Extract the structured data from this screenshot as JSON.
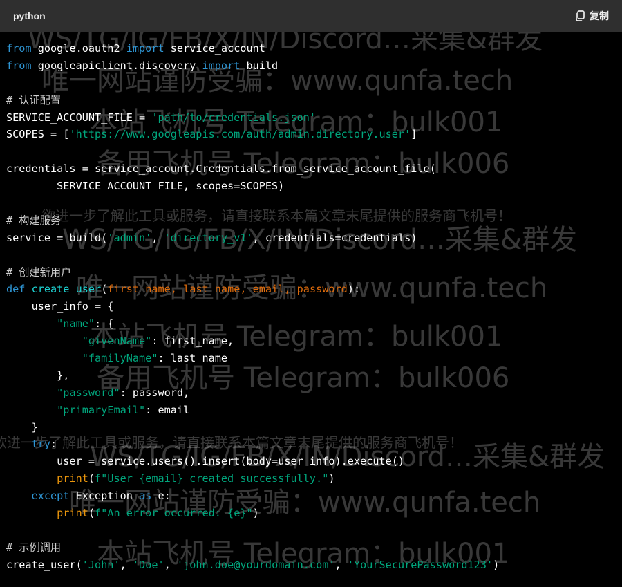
{
  "header": {
    "language": "python",
    "copy_label": "复制",
    "copy_icon": "copy-icon"
  },
  "colors": {
    "keyword": "#2e95d3",
    "function": "#1dd1d1",
    "string": "#00a67d",
    "comment": "#cfcfcf",
    "parameter": "#df6c0c",
    "builtin": "#e9950c",
    "text": "#ffffff",
    "background": "#000000",
    "header_background": "#2f2f2f"
  },
  "code_lines": [
    [
      {
        "t": "from",
        "c": "kw"
      },
      {
        "t": " google.oauth2 "
      },
      {
        "t": "import",
        "c": "kw"
      },
      {
        "t": " service_account"
      }
    ],
    [
      {
        "t": "from",
        "c": "kw"
      },
      {
        "t": " googleapiclient.discovery "
      },
      {
        "t": "import",
        "c": "kw"
      },
      {
        "t": " build"
      }
    ],
    [],
    [
      {
        "t": "# 认证配置",
        "c": "cmt"
      }
    ],
    [
      {
        "t": "SERVICE_ACCOUNT_FILE = "
      },
      {
        "t": "'path/to/credentials.json'",
        "c": "str"
      }
    ],
    [
      {
        "t": "SCOPES = ["
      },
      {
        "t": "'https://www.googleapis.com/auth/admin.directory.user'",
        "c": "str"
      },
      {
        "t": "]"
      }
    ],
    [],
    [
      {
        "t": "credentials = service_account.Credentials.from_service_account_file("
      }
    ],
    [
      {
        "t": "        SERVICE_ACCOUNT_FILE, scopes=SCOPES)"
      }
    ],
    [],
    [
      {
        "t": "# 构建服务",
        "c": "cmt"
      }
    ],
    [
      {
        "t": "service = build("
      },
      {
        "t": "'admin'",
        "c": "str"
      },
      {
        "t": ", "
      },
      {
        "t": "'directory_v1'",
        "c": "str"
      },
      {
        "t": ", credentials=credentials)"
      }
    ],
    [],
    [
      {
        "t": "# 创建新用户",
        "c": "cmt"
      }
    ],
    [
      {
        "t": "def",
        "c": "kw"
      },
      {
        "t": " "
      },
      {
        "t": "create_user",
        "c": "fn"
      },
      {
        "t": "("
      },
      {
        "t": "first_name, last_name, email, password",
        "c": "param"
      },
      {
        "t": "):"
      }
    ],
    [
      {
        "t": "    user_info = {"
      }
    ],
    [
      {
        "t": "        "
      },
      {
        "t": "\"name\"",
        "c": "str"
      },
      {
        "t": ": {"
      }
    ],
    [
      {
        "t": "            "
      },
      {
        "t": "\"givenName\"",
        "c": "str"
      },
      {
        "t": ": first_name,"
      }
    ],
    [
      {
        "t": "            "
      },
      {
        "t": "\"familyName\"",
        "c": "str"
      },
      {
        "t": ": last_name"
      }
    ],
    [
      {
        "t": "        },"
      }
    ],
    [
      {
        "t": "        "
      },
      {
        "t": "\"password\"",
        "c": "str"
      },
      {
        "t": ": password,"
      }
    ],
    [
      {
        "t": "        "
      },
      {
        "t": "\"primaryEmail\"",
        "c": "str"
      },
      {
        "t": ": email"
      }
    ],
    [
      {
        "t": "    }"
      }
    ],
    [
      {
        "t": "    try",
        "c": "kw"
      },
      {
        "t": ":"
      }
    ],
    [
      {
        "t": "        user = service.users().insert(body=user_info).execute()"
      }
    ],
    [
      {
        "t": "        "
      },
      {
        "t": "print",
        "c": "bi"
      },
      {
        "t": "("
      },
      {
        "t": "f\"User {email} created successfully.\"",
        "c": "str"
      },
      {
        "t": ")"
      }
    ],
    [
      {
        "t": "    except",
        "c": "kw"
      },
      {
        "t": " Exception "
      },
      {
        "t": "as",
        "c": "kw"
      },
      {
        "t": " e:"
      }
    ],
    [
      {
        "t": "        "
      },
      {
        "t": "print",
        "c": "bi"
      },
      {
        "t": "("
      },
      {
        "t": "f\"An error occurred: {e}\"",
        "c": "str"
      },
      {
        "t": ")"
      }
    ],
    [],
    [
      {
        "t": "# 示例调用",
        "c": "cmt"
      }
    ],
    [
      {
        "t": "create_user("
      },
      {
        "t": "'John'",
        "c": "str"
      },
      {
        "t": ", "
      },
      {
        "t": "'Doe'",
        "c": "str"
      },
      {
        "t": ", "
      },
      {
        "t": "'john.doe@yourdomain.com'",
        "c": "str"
      },
      {
        "t": ", "
      },
      {
        "t": "'YourSecurePassword123'",
        "c": "str"
      },
      {
        "t": ")"
      }
    ]
  ],
  "watermarks": [
    {
      "text": "WS/TG/IG/FB/X/IN/Discord…采集&群发",
      "size": "big"
    },
    {
      "text": "唯一网站谨防受骗：www.qunfa.tech",
      "size": "big"
    },
    {
      "text": "本站飞机号 Telegram：bulk001",
      "size": "big"
    },
    {
      "text": "备用飞机号 Telegram：bulk006",
      "size": "big"
    },
    {
      "text": "欲进一步了解此工具或服务，请直接联系本篇文章末尾提供的服务商飞机号！",
      "size": "small"
    },
    {
      "text": "WS/TG/IG/FB/X/IN/Discord…采集&群发",
      "size": "big"
    },
    {
      "text": "唯一网站谨防受骗：www.qunfa.tech",
      "size": "big"
    },
    {
      "text": "本站飞机号 Telegram：bulk001",
      "size": "big"
    },
    {
      "text": "备用飞机号 Telegram：bulk006",
      "size": "big"
    },
    {
      "text": "欲进一步了解此工具或服务，请直接联系本篇文章末尾提供的服务商飞机号！",
      "size": "small"
    },
    {
      "text": "WS/TG/IG/FB/X/IN/Discord…采集&群发",
      "size": "big"
    },
    {
      "text": "唯一网站谨防受骗：www.qunfa.tech",
      "size": "big"
    },
    {
      "text": "本站飞机号 Telegram：bulk001",
      "size": "big"
    }
  ]
}
